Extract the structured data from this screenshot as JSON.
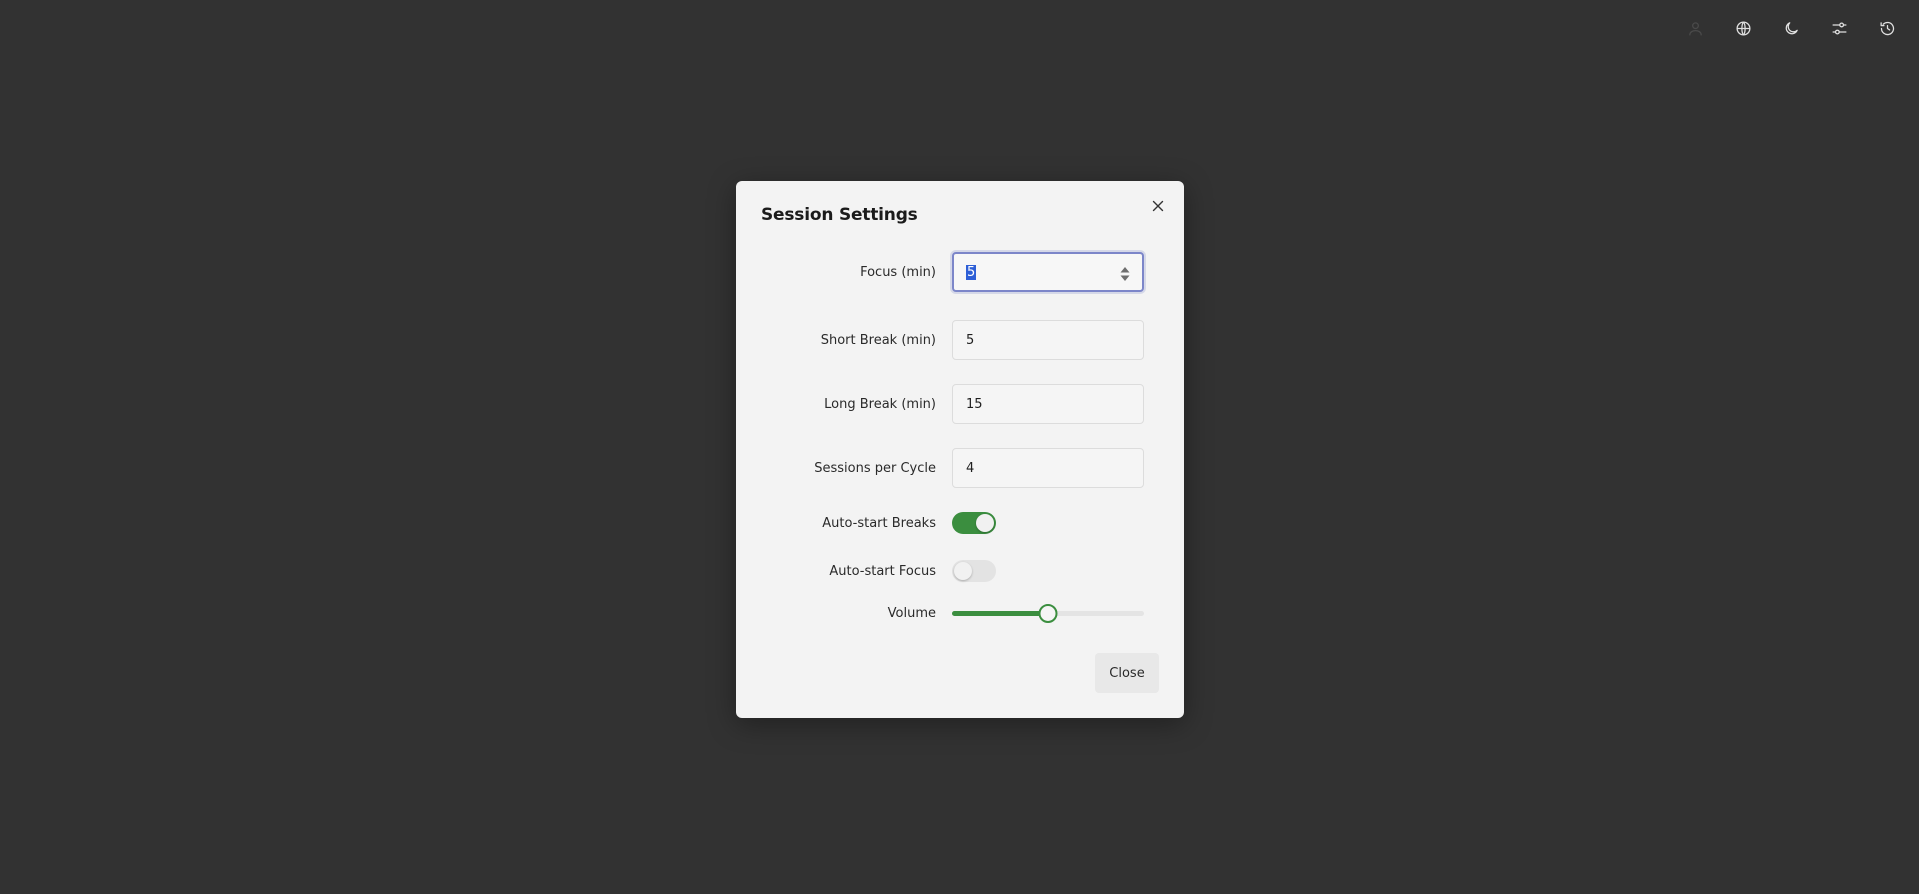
{
  "topbar": {
    "icons": [
      "user-icon",
      "globe-icon",
      "moon-icon",
      "sliders-icon",
      "history-icon"
    ]
  },
  "modal": {
    "title": "Session Settings",
    "fields": {
      "focus": {
        "label": "Focus (min)",
        "value": "5"
      },
      "short_break": {
        "label": "Short Break (min)",
        "value": "5"
      },
      "long_break": {
        "label": "Long Break (min)",
        "value": "15"
      },
      "sessions": {
        "label": "Sessions per Cycle",
        "value": "4"
      }
    },
    "toggles": {
      "auto_breaks": {
        "label": "Auto-start Breaks",
        "on": true
      },
      "auto_focus": {
        "label": "Auto-start Focus",
        "on": false
      }
    },
    "volume": {
      "label": "Volume",
      "level": 0.5
    },
    "close_label": "Close"
  },
  "colors": {
    "accent": "#3b8e3f",
    "focus_ring": "#7c86c9",
    "backdrop": "#323232",
    "modal_bg": "#f3f3f3"
  }
}
